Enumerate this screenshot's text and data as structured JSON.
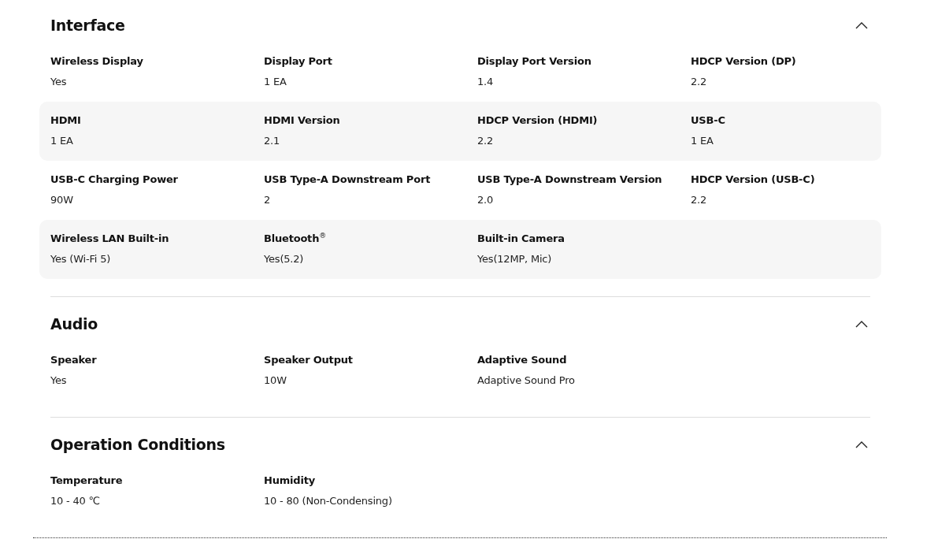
{
  "sections": [
    {
      "title": "Interface",
      "expanded": true,
      "rows": [
        {
          "shaded": false,
          "specs": [
            {
              "label": "Wireless Display",
              "value": "Yes"
            },
            {
              "label": "Display Port",
              "value": "1 EA"
            },
            {
              "label": "Display Port Version",
              "value": "1.4"
            },
            {
              "label": "HDCP Version (DP)",
              "value": "2.2"
            }
          ]
        },
        {
          "shaded": true,
          "specs": [
            {
              "label": "HDMI",
              "value": "1 EA"
            },
            {
              "label": "HDMI Version",
              "value": "2.1"
            },
            {
              "label": "HDCP Version (HDMI)",
              "value": "2.2"
            },
            {
              "label": "USB-C",
              "value": "1 EA"
            }
          ]
        },
        {
          "shaded": false,
          "specs": [
            {
              "label": "USB-C Charging Power",
              "value": "90W"
            },
            {
              "label": "USB Type-A Downstream Port",
              "value": "2"
            },
            {
              "label": "USB Type-A Downstream Version",
              "value": "2.0"
            },
            {
              "label": "HDCP Version (USB-C)",
              "value": "2.2"
            }
          ]
        },
        {
          "shaded": true,
          "specs": [
            {
              "label": "Wireless LAN Built-in",
              "value": "Yes (Wi-Fi 5)"
            },
            {
              "label": "Bluetooth$^{®}$",
              "value": "Yes(5.2)"
            },
            {
              "label": "Built-in Camera",
              "value": "Yes(12MP, Mic)"
            }
          ]
        }
      ]
    },
    {
      "title": "Audio",
      "expanded": true,
      "rows": [
        {
          "shaded": false,
          "specs": [
            {
              "label": "Speaker",
              "value": "Yes"
            },
            {
              "label": "Speaker Output",
              "value": "10W"
            },
            {
              "label": "Adaptive Sound",
              "value": "Adaptive Sound Pro"
            }
          ]
        }
      ]
    },
    {
      "title": "Operation Conditions",
      "expanded": true,
      "rows": [
        {
          "shaded": false,
          "specs": [
            {
              "label": "Temperature",
              "value": "10 - 40 ℃"
            },
            {
              "label": "Humidity",
              "value": "10 - 80 (Non-Condensing)"
            }
          ]
        }
      ]
    }
  ]
}
